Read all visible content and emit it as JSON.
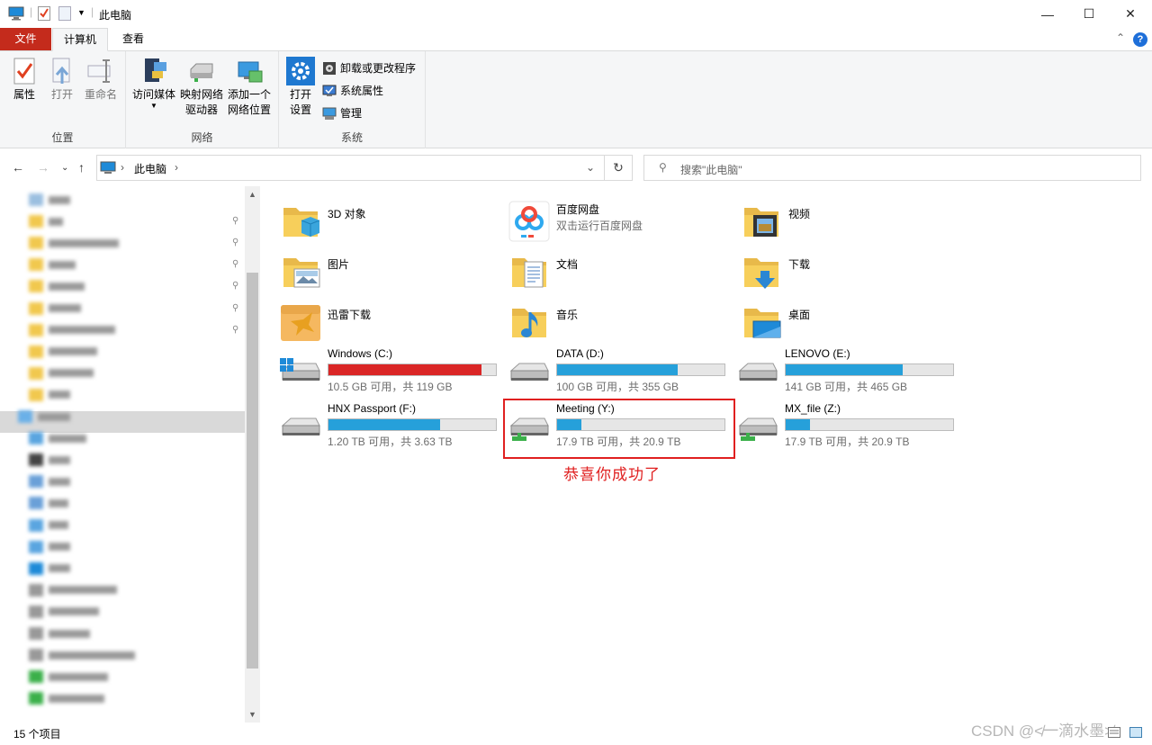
{
  "window": {
    "title": "此电脑",
    "minimize": "—",
    "maximize": "☐",
    "close": "✕"
  },
  "ribbon_tabs": [
    "文件",
    "计算机",
    "查看"
  ],
  "ribbon": {
    "groups": {
      "location": {
        "label": "位置",
        "properties": "属性",
        "open": "打开",
        "rename": "重命名"
      },
      "network": {
        "label": "网络",
        "access_media": "访问媒体",
        "map_drive_1": "映射网络",
        "map_drive_2": "驱动器",
        "add_location_1": "添加一个",
        "add_location_2": "网络位置"
      },
      "system": {
        "label": "系统",
        "open_settings_1": "打开",
        "open_settings_2": "设置",
        "uninstall": "卸载或更改程序",
        "sys_props": "系统属性",
        "manage": "管理"
      }
    }
  },
  "address": {
    "path": "此电脑",
    "search_placeholder": "搜索\"此电脑\""
  },
  "folders": [
    {
      "name": "3D 对象",
      "icon": "3d-objects-folder-icon"
    },
    {
      "name": "百度网盘",
      "sub": "双击运行百度网盘",
      "icon": "baidu-netdisk-icon"
    },
    {
      "name": "视频",
      "icon": "videos-folder-icon"
    },
    {
      "name": "图片",
      "icon": "pictures-folder-icon"
    },
    {
      "name": "文档",
      "icon": "documents-folder-icon"
    },
    {
      "name": "下载",
      "icon": "downloads-folder-icon"
    },
    {
      "name": "迅雷下载",
      "icon": "xunlei-download-icon"
    },
    {
      "name": "音乐",
      "icon": "music-folder-icon"
    },
    {
      "name": "桌面",
      "icon": "desktop-folder-icon"
    }
  ],
  "drives": [
    {
      "name": "Windows (C:)",
      "free": "10.5 GB 可用，共 119 GB",
      "used_fraction": 0.912,
      "color": "#da2626",
      "type": "system"
    },
    {
      "name": "DATA (D:)",
      "free": "100 GB 可用，共 355 GB",
      "used_fraction": 0.718,
      "color": "#26a0da",
      "type": "local"
    },
    {
      "name": "LENOVO (E:)",
      "free": "141 GB 可用，共 465 GB",
      "used_fraction": 0.697,
      "color": "#26a0da",
      "type": "local"
    },
    {
      "name": "HNX Passport (F:)",
      "free": "1.20 TB 可用，共 3.63 TB",
      "used_fraction": 0.669,
      "color": "#26a0da",
      "type": "local"
    },
    {
      "name": "Meeting (Y:)",
      "free": "17.9 TB 可用，共 20.9 TB",
      "used_fraction": 0.144,
      "color": "#26a0da",
      "type": "network"
    },
    {
      "name": "MX_file (Z:)",
      "free": "17.9 TB 可用，共 20.9 TB",
      "used_fraction": 0.144,
      "color": "#26a0da",
      "type": "network"
    }
  ],
  "annotation": "恭喜你成功了",
  "status": "15 个项目",
  "watermark": "CSDN @≮一滴水墨≯"
}
